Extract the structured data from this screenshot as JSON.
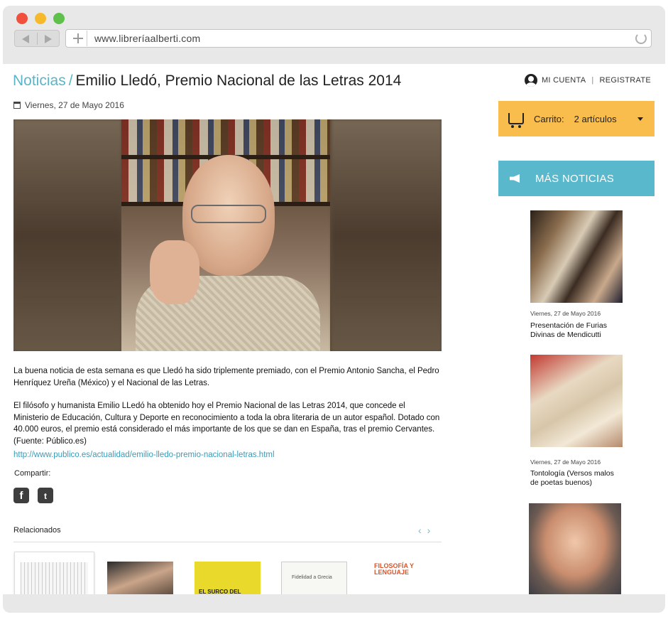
{
  "browser": {
    "url": "www.libreríaalberti.com"
  },
  "header": {
    "breadcrumb_parent": "Noticias",
    "breadcrumb_separator": "/",
    "title": "Emilio Lledó, Premio Nacional de las Letras 2014",
    "account_label": "MI CUENTA",
    "account_sep": "|",
    "register_label": "REGISTRATE"
  },
  "article": {
    "date": "Viernes, 27 de Mayo 2016",
    "paragraph1": "La buena noticia de esta semana es que Lledó ha sido triplemente premiado, con el Premio Antonio Sancha, el Pedro Henríquez Ureña (México) y el Nacional de las Letras.",
    "paragraph2": "El filósofo y humanista Emilio LLedó ha obtenido hoy el Premio Nacional de las Letras 2014, que concede el Ministerio de Educación, Cultura y Deporte en reconocimiento a toda la obra literaria de un autor español. Dotado con 40.000 euros, el premio está considerado el más importante de los que se dan en España, tras el premio Cervantes. (Fuente: Público.es)",
    "link": "http://www.publico.es/actualidad/emilio-lledo-premio-nacional-letras.html",
    "share_label": "Compartir:",
    "related_label": "Relacionados",
    "related_prev": "‹",
    "related_next": "›"
  },
  "related_books": [
    {
      "cover_text": ""
    },
    {
      "cover_text": ""
    },
    {
      "cover_text": "EL SURCO DEL TIEMPO"
    },
    {
      "cover_text": "Fidelidad a Grecia"
    },
    {
      "cover_text": "FILOSOFÍA Y LENGUAJE"
    }
  ],
  "cart": {
    "label": "Carrito:",
    "count": "2 artículos"
  },
  "sidebar": {
    "heading": "MÁS NOTICIAS",
    "items": [
      {
        "date": "Viernes, 27 de Mayo 2016",
        "title": "Presentación de Furias Divinas de Mendicutti"
      },
      {
        "date": "Viernes, 27 de Mayo 2016",
        "title": "Tontología (Versos malos de poetas buenos)"
      }
    ]
  },
  "colors": {
    "accent_teal": "#5ab8cc",
    "cart_yellow": "#f9bd4d",
    "link_blue": "#3a9bb8"
  }
}
